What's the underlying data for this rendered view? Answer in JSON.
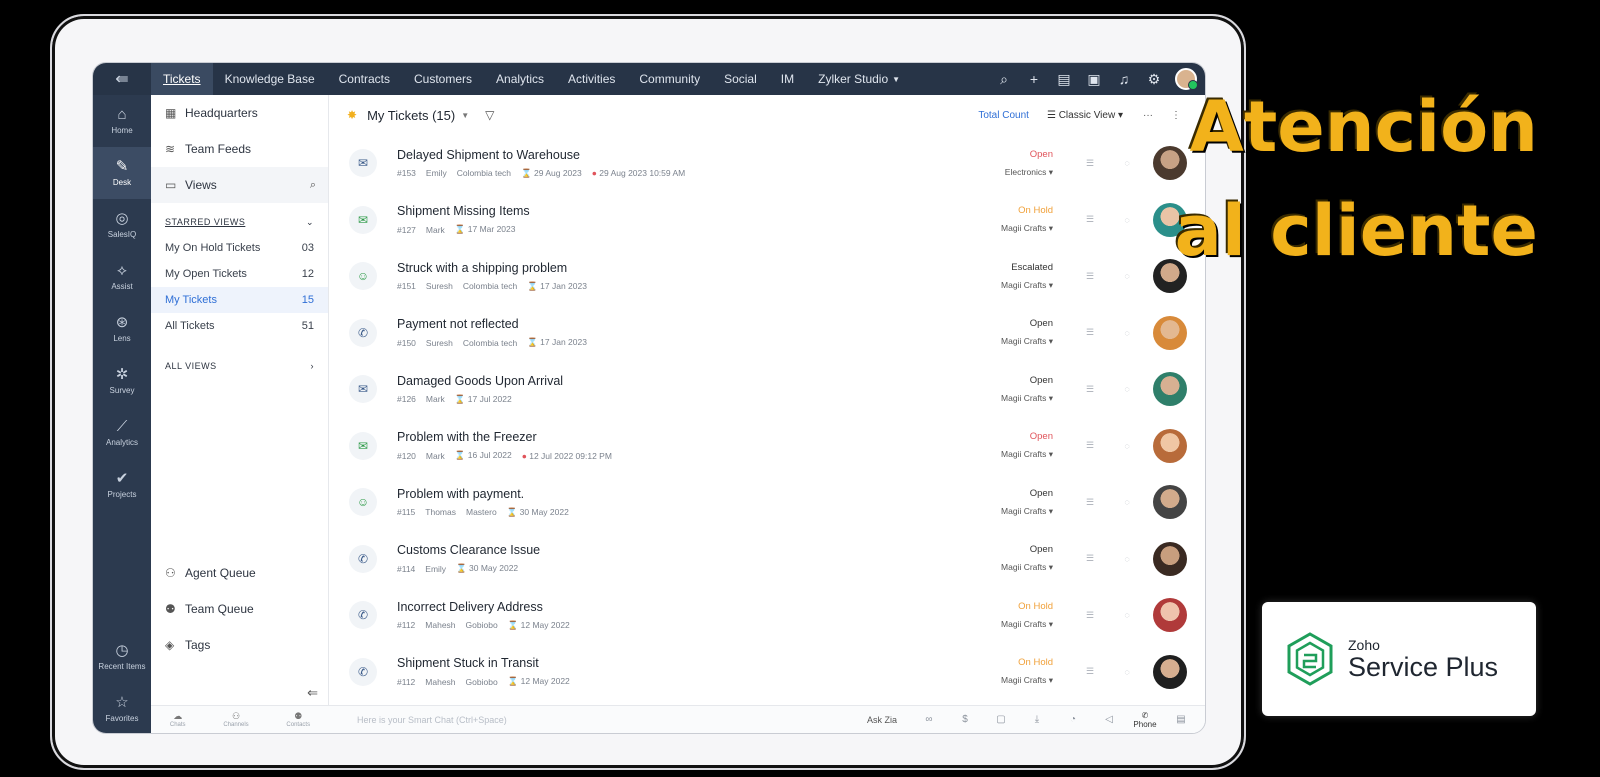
{
  "topbar": {
    "tabs": [
      "Tickets",
      "Knowledge Base",
      "Contracts",
      "Customers",
      "Analytics",
      "Activities",
      "Community",
      "Social",
      "IM",
      "Zylker Studio"
    ]
  },
  "rail": {
    "items": [
      {
        "label": "Home",
        "icon": "⌂"
      },
      {
        "label": "Desk",
        "icon": "✎"
      },
      {
        "label": "SalesIQ",
        "icon": "◎"
      },
      {
        "label": "Assist",
        "icon": "⟡"
      },
      {
        "label": "Lens",
        "icon": "⊛"
      },
      {
        "label": "Survey",
        "icon": "✲"
      },
      {
        "label": "Analytics",
        "icon": "⟋"
      },
      {
        "label": "Projects",
        "icon": "✔"
      }
    ],
    "bottom": [
      {
        "label": "Recent Items",
        "icon": "◷"
      },
      {
        "label": "Favorites",
        "icon": "☆"
      }
    ]
  },
  "nav": {
    "headquarters": "Headquarters",
    "team_feeds": "Team Feeds",
    "views": "Views",
    "starred_views": "STARRED VIEWS",
    "starred": [
      {
        "label": "My On Hold Tickets",
        "count": "03"
      },
      {
        "label": "My Open Tickets",
        "count": "12"
      },
      {
        "label": "My Tickets",
        "count": "15"
      },
      {
        "label": "All Tickets",
        "count": "51"
      }
    ],
    "all_views": "ALL VIEWS",
    "agent_queue": "Agent Queue",
    "team_queue": "Team Queue",
    "tags": "Tags"
  },
  "main": {
    "title": "My Tickets (15)",
    "total_count": "Total Count",
    "classic_view": "Classic View",
    "tickets": [
      {
        "title": "Delayed Shipment to Warehouse",
        "id": "#153",
        "agent": "Emily",
        "account": "Colombia tech",
        "due": "29 Aug 2023",
        "extra": "29 Aug 2023 10:59 AM",
        "status": "Open",
        "department": "Electronics"
      },
      {
        "title": "Shipment Missing Items",
        "id": "#127",
        "agent": "Mark",
        "account": "",
        "due": "17 Mar 2023",
        "extra": "",
        "status": "On Hold",
        "department": "Magii Crafts"
      },
      {
        "title": "Struck with a shipping problem",
        "id": "#151",
        "agent": "Suresh",
        "account": "Colombia tech",
        "due": "17 Jan 2023",
        "extra": "",
        "status": "Escalated",
        "department": "Magii Crafts"
      },
      {
        "title": "Payment not reflected",
        "id": "#150",
        "agent": "Suresh",
        "account": "Colombia tech",
        "due": "17 Jan 2023",
        "extra": "",
        "status": "Open",
        "department": "Magii Crafts"
      },
      {
        "title": "Damaged Goods Upon Arrival",
        "id": "#126",
        "agent": "Mark",
        "account": "",
        "due": "17 Jul 2022",
        "extra": "",
        "status": "Open",
        "department": "Magii Crafts"
      },
      {
        "title": "Problem with the Freezer",
        "id": "#120",
        "agent": "Mark",
        "account": "",
        "due": "16 Jul 2022",
        "extra": "12 Jul 2022 09:12 PM",
        "status": "Open",
        "department": "Magii Crafts"
      },
      {
        "title": "Problem with payment.",
        "id": "#115",
        "agent": "Thomas",
        "account": "Mastero",
        "due": "30 May 2022",
        "extra": "",
        "status": "Open",
        "department": "Magii Crafts"
      },
      {
        "title": "Customs Clearance Issue",
        "id": "#114",
        "agent": "Emily",
        "account": "",
        "due": "30 May 2022",
        "extra": "",
        "status": "Open",
        "department": "Magii Crafts"
      },
      {
        "title": "Incorrect Delivery Address",
        "id": "#112",
        "agent": "Mahesh",
        "account": "Gobiobo",
        "due": "12 May 2022",
        "extra": "",
        "status": "On Hold",
        "department": "Magii Crafts"
      },
      {
        "title": "Shipment Stuck in Transit",
        "id": "#112",
        "agent": "Mahesh",
        "account": "Gobiobo",
        "due": "12 May 2022",
        "extra": "",
        "status": "On Hold",
        "department": "Magii Crafts"
      }
    ]
  },
  "statusbar": {
    "quick": [
      "Chats",
      "Channels",
      "Contacts"
    ],
    "chat_placeholder": "Here is your Smart Chat (Ctrl+Space)",
    "ask_zia": "Ask Zia",
    "phone": "Phone"
  },
  "overlay": {
    "line1": "Atención",
    "line2": "al cliente"
  },
  "logo": {
    "small": "Zoho",
    "big": "Service Plus"
  },
  "colors": {
    "accent": "#f2b21b",
    "topbar": "#273447",
    "link": "#2f6fd6",
    "open_red": "#e0545b",
    "hold": "#f0a13a"
  }
}
